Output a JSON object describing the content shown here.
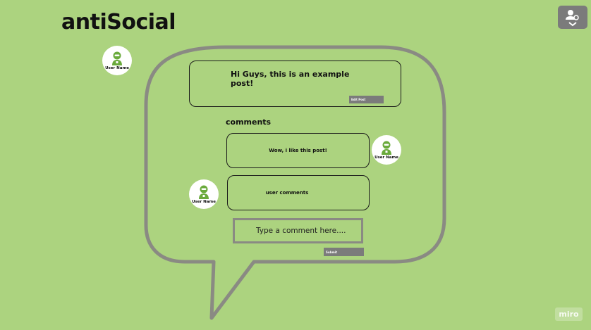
{
  "app": {
    "title": "antiSocial"
  },
  "post": {
    "author": "User Name",
    "text": "Hi Guys, this is an example post!",
    "edit_label": "Edit Post"
  },
  "comments_section": {
    "label": "comments",
    "items": [
      {
        "author": "User Name",
        "text": "Wow, i like this post!"
      },
      {
        "author": "User Name",
        "text": "user comments"
      }
    ],
    "input_placeholder": "Type a comment here....",
    "submit_label": "Submit"
  },
  "footer": {
    "watermark": "miro"
  },
  "colors": {
    "background": "#acd37f",
    "bubble_stroke": "#8a8a83",
    "button_gray": "#7b7b7b",
    "avatar_green": "#6aaa3c"
  },
  "icons": {
    "corner": "user-settings-icon",
    "avatar": "user-avatar-icon"
  }
}
